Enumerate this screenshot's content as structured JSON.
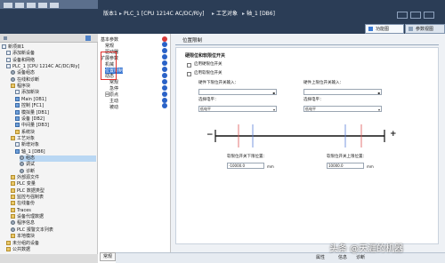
{
  "topbar": {
    "path": [
      "版本1",
      "PLC_1 [CPU 1214C AC/DC/Rly]",
      "工艺对象",
      "轴_1 [DB6]"
    ],
    "right_tabs": [
      "功能图",
      "参数视图"
    ]
  },
  "tree": {
    "items": [
      {
        "label": "新项目1",
        "indent": 0,
        "icon": "project"
      },
      {
        "label": "添加新设备",
        "indent": 1,
        "icon": "add"
      },
      {
        "label": "设备和网络",
        "indent": 1,
        "icon": "network"
      },
      {
        "label": "PLC_1 [CPU 1214C AC/DC/Rly]",
        "indent": 1,
        "icon": "cpu"
      },
      {
        "label": "设备组态",
        "indent": 2,
        "icon": "gear"
      },
      {
        "label": "在线和诊断",
        "indent": 2,
        "icon": "gear"
      },
      {
        "label": "程序块",
        "indent": 2,
        "icon": "folder"
      },
      {
        "label": "添加新块",
        "indent": 3,
        "icon": "add"
      },
      {
        "label": "Main [OB1]",
        "indent": 3,
        "icon": "block"
      },
      {
        "label": "控制 [FC1]",
        "indent": 3,
        "icon": "block"
      },
      {
        "label": "模拟量 [DB1]",
        "indent": 3,
        "icon": "block"
      },
      {
        "label": "设备 [DB2]",
        "indent": 3,
        "icon": "block"
      },
      {
        "label": "中间量 [DB3]",
        "indent": 3,
        "icon": "block"
      },
      {
        "label": "系统块",
        "indent": 3,
        "icon": "folder"
      },
      {
        "label": "工艺对象",
        "indent": 2,
        "icon": "folder"
      },
      {
        "label": "新增对象",
        "indent": 3,
        "icon": "add"
      },
      {
        "label": "轴_1 [DB6]",
        "indent": 3,
        "icon": "block"
      },
      {
        "label": "组态",
        "indent": 4,
        "icon": "gear",
        "selected": true
      },
      {
        "label": "调试",
        "indent": 4,
        "icon": "gear"
      },
      {
        "label": "诊断",
        "indent": 4,
        "icon": "gear"
      },
      {
        "label": "外部源文件",
        "indent": 2,
        "icon": "folder"
      },
      {
        "label": "PLC 变量",
        "indent": 2,
        "icon": "folder"
      },
      {
        "label": "PLC 数据类型",
        "indent": 2,
        "icon": "folder"
      },
      {
        "label": "监控与强制表",
        "indent": 2,
        "icon": "folder"
      },
      {
        "label": "在线备份",
        "indent": 2,
        "icon": "folder"
      },
      {
        "label": "Traces",
        "indent": 2,
        "icon": "folder"
      },
      {
        "label": "设备代理数据",
        "indent": 2,
        "icon": "folder"
      },
      {
        "label": "程序信息",
        "indent": 2,
        "icon": "gear"
      },
      {
        "label": "PLC 报警文本列表",
        "indent": 2,
        "icon": "gear"
      },
      {
        "label": "本地模块",
        "indent": 2,
        "icon": "folder"
      },
      {
        "label": "未分组的设备",
        "indent": 1,
        "icon": "folder"
      },
      {
        "label": "公共数据",
        "indent": 1,
        "icon": "folder"
      }
    ]
  },
  "subnav": {
    "items": [
      {
        "label": "基本参数",
        "indent": 0,
        "status": "err"
      },
      {
        "label": "常规",
        "indent": 1,
        "status": "ok"
      },
      {
        "label": "驱动器",
        "indent": 1,
        "status": "ok"
      },
      {
        "label": "扩展参数",
        "indent": 0,
        "status": "ok"
      },
      {
        "label": "机械",
        "indent": 1,
        "status": "ok"
      },
      {
        "label": "位置限制",
        "indent": 1,
        "status": "ok",
        "highlight": true
      },
      {
        "label": "动态",
        "indent": 1,
        "status": "ok"
      },
      {
        "label": "常规",
        "indent": 2,
        "status": "ok"
      },
      {
        "label": "急停",
        "indent": 2,
        "status": "ok"
      },
      {
        "label": "回原点",
        "indent": 1,
        "status": "ok"
      },
      {
        "label": "主动",
        "indent": 2,
        "status": "ok"
      },
      {
        "label": "被动",
        "indent": 2,
        "status": "ok"
      }
    ]
  },
  "main": {
    "section_title": "位置限制",
    "group_title": "硬限位和软限位开关",
    "cb_hw_label": "启用硬限位开关",
    "cb_sw_label": "启用软限位开关",
    "hw_low_label": "硬件下限位开关输入：",
    "hw_high_label": "硬件上限位开关输入：",
    "select_level_label": "选择电平：",
    "low_level_value": "低电平",
    "high_level_value": "低电平",
    "sw_low_label": "软限位开关下限位置：",
    "sw_high_label": "软限位开关上限位置：",
    "sw_low_value": "-10000.0",
    "sw_high_value": "10000.0",
    "unit": "mm",
    "minus": "−",
    "plus": "+"
  },
  "bottom": {
    "tab": "常规",
    "watermark": "头条 @天涯的机器",
    "attribute_tab": "属性",
    "info_tab": "信息",
    "diag_tab": "诊断"
  },
  "colors": {
    "topbar": "#2b3d56",
    "accent_blue": "#2a62c7",
    "error_red": "#d83b3b",
    "highlight_box": "#e0302b",
    "marker_red": "#e05555",
    "marker_blue": "#5a7fd8"
  }
}
